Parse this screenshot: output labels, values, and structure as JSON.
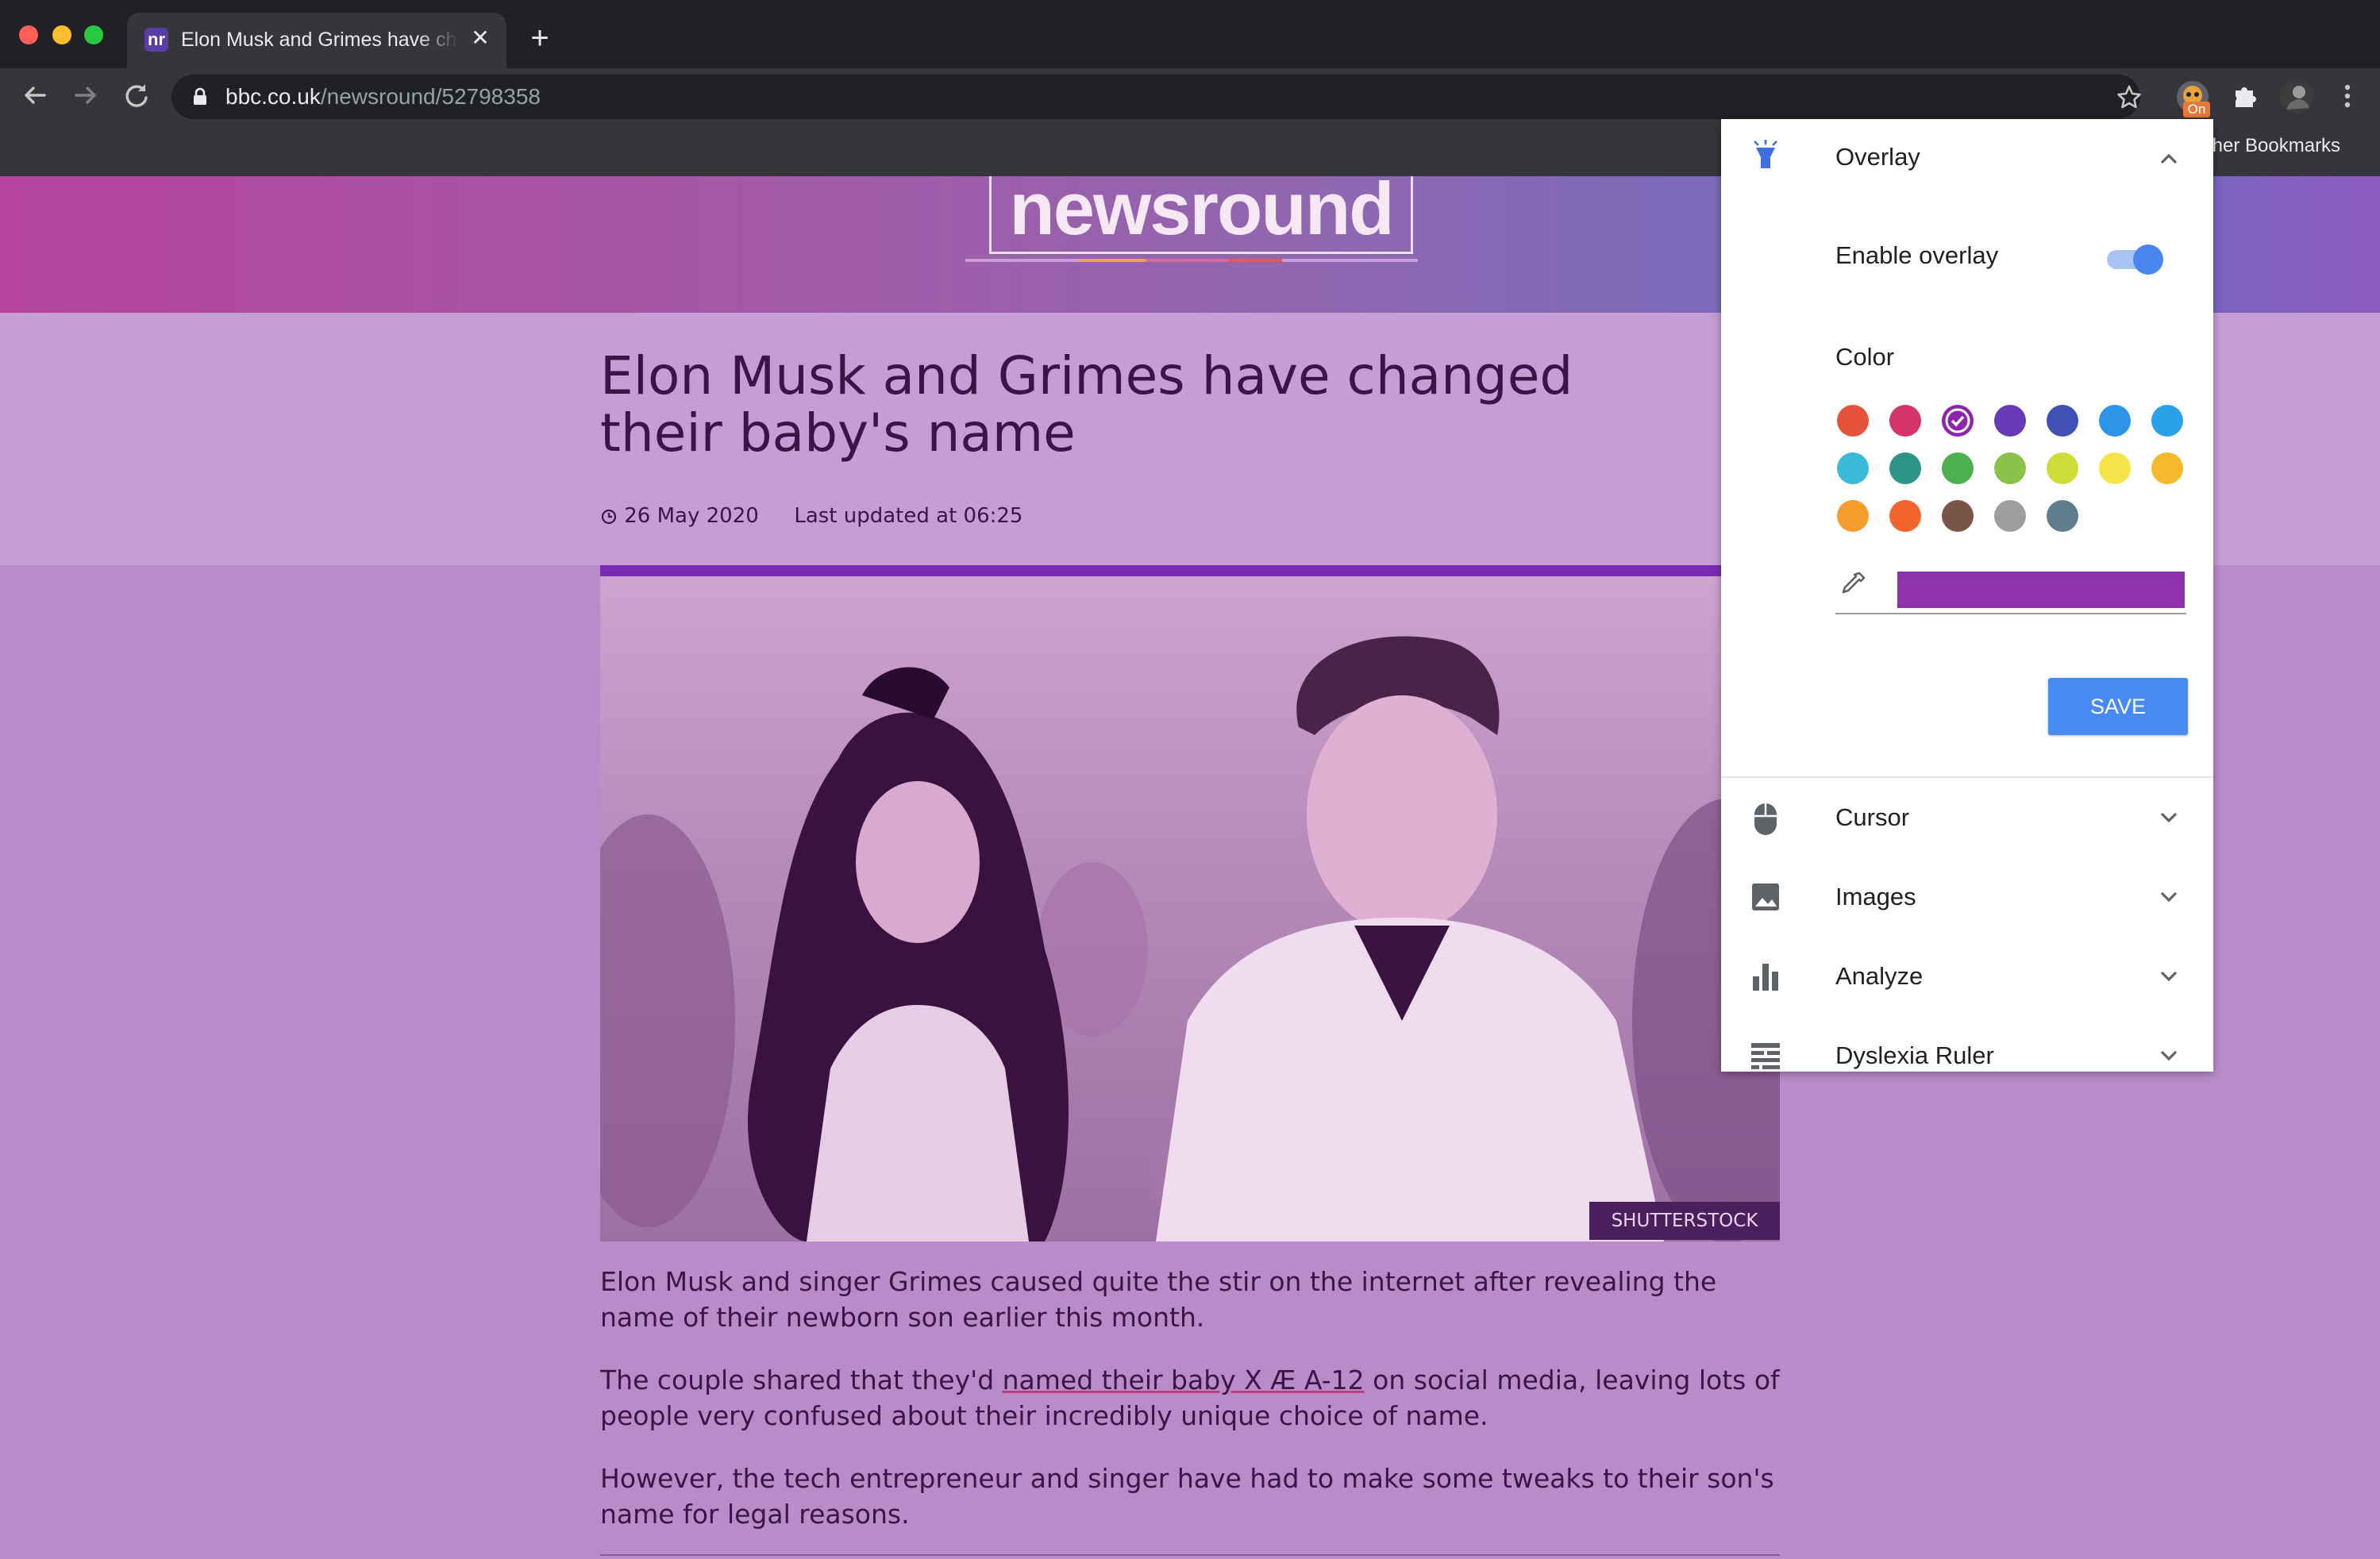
{
  "browser": {
    "tab_title": "Elon Musk and Grimes have changed their baby's name",
    "tab_favicon": "nr",
    "tab_close": "✕",
    "new_tab": "+",
    "url_host": "bbc.co.uk",
    "url_path": "/newsround/52798358",
    "bookmarks_label": "ther Bookmarks",
    "extension_badge": "On"
  },
  "page": {
    "logo": "newsround",
    "headline": "Elon Musk and Grimes have changed their baby's name",
    "date": "26 May 2020",
    "updated": "Last updated at 06:25",
    "image_credit": "SHUTTERSTOCK",
    "paragraphs": [
      "Elon Musk and singer Grimes caused quite the stir on the internet after revealing the name of their newborn son earlier this month.",
      "However, the tech entrepreneur and singer have had to make some tweaks to their son's name for legal reasons."
    ],
    "para2_before": "The couple shared that they'd ",
    "para2_link": "named their baby X Æ A-12",
    "para2_after": " on social media, leaving lots of people very confused about their incredibly unique choice of name."
  },
  "popup": {
    "overlay_title": "Overlay",
    "enable_label": "Enable overlay",
    "enable_on": true,
    "color_label": "Color",
    "swatches": [
      "#e5533d",
      "#d6336c",
      "#8e24aa",
      "#673ab7",
      "#3f51b5",
      "#2f94e8",
      "#29a2ea",
      "#3cb9d6",
      "#2e9488",
      "#4caf50",
      "#8bc34a",
      "#cddc39",
      "#f7e34a",
      "#f6b92b",
      "#f49d2c",
      "#f0642c",
      "#795548",
      "#9e9e9e",
      "#607d8b"
    ],
    "selected_swatch": "#8e24aa",
    "custom_color": "#9132ad",
    "save_label": "SAVE",
    "sections": [
      {
        "label": "Cursor",
        "icon": "mouse-icon"
      },
      {
        "label": "Images",
        "icon": "image-icon"
      },
      {
        "label": "Analyze",
        "icon": "bar-chart-icon"
      },
      {
        "label": "Dyslexia Ruler",
        "icon": "ruler-icon"
      }
    ]
  }
}
